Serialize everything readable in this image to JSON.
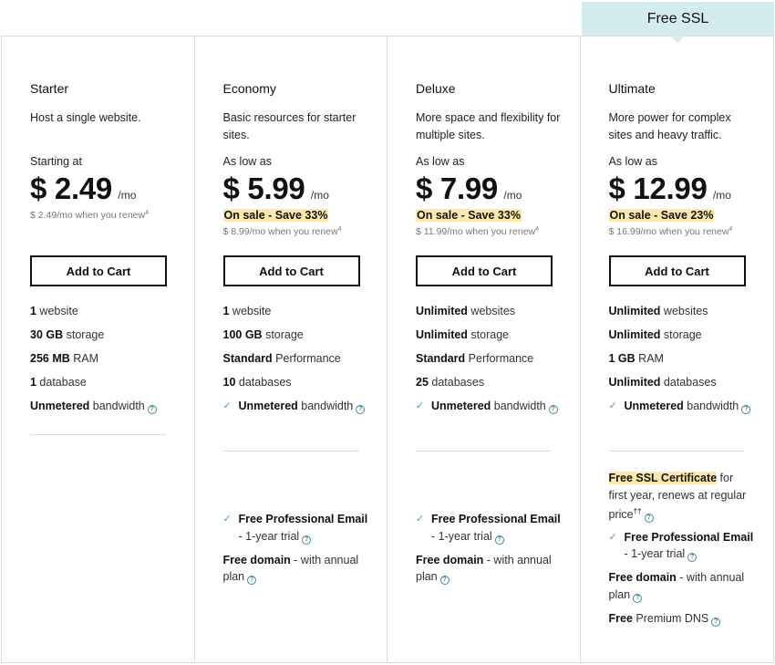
{
  "badge": {
    "label": "Free SSL",
    "color": "#d4ecee"
  },
  "help_glyph": "?",
  "check_glyph": "✓",
  "plans": [
    {
      "name": "Starter",
      "description": "Host a single website.",
      "price_label": "Starting at",
      "price": "$ 2.49",
      "per": "/mo",
      "sale": null,
      "renew": "$ 2.49/mo when you renew",
      "renew_footnote": "4",
      "cart_label": "Add to Cart",
      "features": [
        {
          "bold": "1",
          "text": " website"
        },
        {
          "bold": "30 GB",
          "text": " storage"
        },
        {
          "bold": "256 MB",
          "text": " RAM"
        },
        {
          "bold": "1",
          "text": " database"
        },
        {
          "bold": "Unmetered",
          "text": " bandwidth",
          "help": true
        }
      ]
    },
    {
      "name": "Economy",
      "description": "Basic resources for starter sites.",
      "price_label": "As low as",
      "price": "$ 5.99",
      "per": "/mo",
      "sale": "On sale - Save 33%",
      "renew": "$ 8.99/mo when you renew",
      "renew_footnote": "4",
      "cart_label": "Add to Cart",
      "features": [
        {
          "bold": "1",
          "text": " website"
        },
        {
          "bold": "100 GB",
          "text": " storage"
        },
        {
          "bold": "Standard",
          "text": " Performance"
        },
        {
          "bold": "10",
          "text": " databases"
        },
        {
          "bold": "Unmetered",
          "text": " bandwidth",
          "help": true,
          "check": true
        }
      ],
      "extras": [
        {
          "bold": "Free Professional Email",
          "text": " - 1-year trial",
          "check": true,
          "help": true
        },
        {
          "bold": "Free domain",
          "text": " - with annual plan",
          "help": true
        }
      ]
    },
    {
      "name": "Deluxe",
      "description": "More space and flexibility for multiple sites.",
      "price_label": "As low as",
      "price": "$ 7.99",
      "per": "/mo",
      "sale": "On sale - Save 33%",
      "renew": "$ 11.99/mo when you renew",
      "renew_footnote": "4",
      "cart_label": "Add to Cart",
      "features": [
        {
          "bold": "Unlimited",
          "text": " websites"
        },
        {
          "bold": "Unlimited",
          "text": " storage"
        },
        {
          "bold": "Standard",
          "text": " Performance"
        },
        {
          "bold": "25",
          "text": " databases"
        },
        {
          "bold": "Unmetered",
          "text": " bandwidth",
          "help": true,
          "check": true
        }
      ],
      "extras": [
        {
          "bold": "Free Professional Email",
          "text": " - 1-year trial",
          "check": true,
          "help": true
        },
        {
          "bold": "Free domain",
          "text": " - with annual plan",
          "help": true
        }
      ]
    },
    {
      "name": "Ultimate",
      "description": "More power for complex sites and heavy traffic.",
      "price_label": "As low as",
      "price": "$ 12.99",
      "per": "/mo",
      "sale": "On sale - Save 23%",
      "renew": "$ 16.99/mo when you renew",
      "renew_footnote": "4",
      "cart_label": "Add to Cart",
      "features": [
        {
          "bold": "Unlimited",
          "text": " websites"
        },
        {
          "bold": "Unlimited",
          "text": " storage"
        },
        {
          "bold": "1 GB",
          "text": " RAM"
        },
        {
          "bold": "Unlimited",
          "text": " databases"
        },
        {
          "bold": "Unmetered",
          "text": " bandwidth",
          "help": true,
          "check": true
        }
      ],
      "ssl": {
        "bold": "Free SSL Certificate",
        "text": " for first year, renews at regular price",
        "footnote": "††"
      },
      "extras": [
        {
          "bold": "Free Professional Email",
          "text": " - 1-year trial",
          "check": true,
          "help": true
        },
        {
          "bold": "Free domain",
          "text": " - with annual plan",
          "help": true
        },
        {
          "bold": "Free",
          "text": " Premium DNS",
          "help": true
        }
      ]
    }
  ]
}
